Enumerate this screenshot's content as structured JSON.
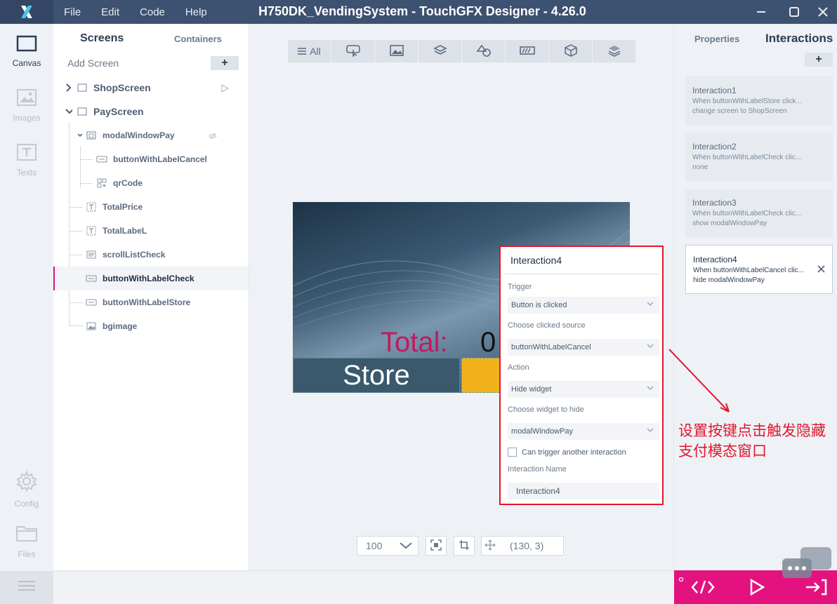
{
  "window": {
    "title": "H750DK_VendingSystem - TouchGFX Designer - 4.26.0",
    "menu": [
      "File",
      "Edit",
      "Code",
      "Help"
    ]
  },
  "rail": {
    "items": [
      {
        "label": "Canvas",
        "icon": "canvas-icon",
        "active": true
      },
      {
        "label": "Images",
        "icon": "images-icon"
      },
      {
        "label": "Texts",
        "icon": "texts-icon"
      },
      {
        "label": "Config",
        "icon": "gear-icon"
      },
      {
        "label": "Files",
        "icon": "folder-icon"
      }
    ]
  },
  "tree": {
    "tabs": [
      "Screens",
      "Containers"
    ],
    "add_screen_label": "Add Screen",
    "add_button": "+",
    "rows": [
      {
        "label": "ShopScreen",
        "kind": "screen",
        "expanded": false
      },
      {
        "label": "PayScreen",
        "kind": "screen",
        "expanded": true
      },
      {
        "label": "modalWindowPay",
        "kind": "container"
      },
      {
        "label": "buttonWithLabelCancel",
        "kind": "button"
      },
      {
        "label": "qrCode",
        "kind": "qr"
      },
      {
        "label": "TotalPrice",
        "kind": "text"
      },
      {
        "label": "TotalLabeL",
        "kind": "text"
      },
      {
        "label": "scrollListCheck",
        "kind": "list"
      },
      {
        "label": "buttonWithLabelCheck",
        "kind": "button",
        "selected": true
      },
      {
        "label": "buttonWithLabelStore",
        "kind": "button"
      },
      {
        "label": "bgimage",
        "kind": "image"
      }
    ]
  },
  "canvas": {
    "toolbar": [
      {
        "label": "All",
        "icon": "list-icon"
      },
      {
        "icon": "interaction-icon"
      },
      {
        "icon": "image-icon"
      },
      {
        "icon": "layers-icon"
      },
      {
        "icon": "shapes-icon"
      },
      {
        "icon": "progress-icon"
      },
      {
        "icon": "cube-icon"
      },
      {
        "icon": "stack-icon"
      }
    ],
    "preview": {
      "total_label": "Total:",
      "total_value": "0",
      "store_button": "Store"
    },
    "zoom": "100",
    "coords": "(130, 3)"
  },
  "popup": {
    "title": "Interaction4",
    "trigger_label": "Trigger",
    "trigger_value": "Button is clicked",
    "source_label": "Choose clicked source",
    "source_value": "buttonWithLabelCancel",
    "action_label": "Action",
    "action_value": "Hide widget",
    "widget_label": "Choose widget to hide",
    "widget_value": "modalWindowPay",
    "can_trigger_label": "Can trigger another interaction",
    "name_label": "Interaction Name",
    "name_value": "Interaction4"
  },
  "rightpanel": {
    "tabs": [
      "Properties",
      "Interactions"
    ],
    "add_button": "+",
    "interactions": [
      {
        "title": "Interaction1",
        "line1": "When buttonWithLabelStore click...",
        "line2": "change screen to ShopScreen"
      },
      {
        "title": "Interaction2",
        "line1": "When buttonWithLabelCheck clic...",
        "line2": "none"
      },
      {
        "title": "Interaction3",
        "line1": "When buttonWithLabelCheck clic...",
        "line2": "show modalWindowPay"
      },
      {
        "title": "Interaction4",
        "line1": "When buttonWithLabelCancel clic...",
        "line2": "hide modalWindowPay",
        "active": true
      }
    ]
  },
  "annotation": {
    "line1": "设置按键点击触发隐藏",
    "line2": "支付模态窗口"
  },
  "colors": {
    "accent": "#e4127f",
    "annotation": "#e0182d",
    "titlebar": "#3d5170"
  }
}
